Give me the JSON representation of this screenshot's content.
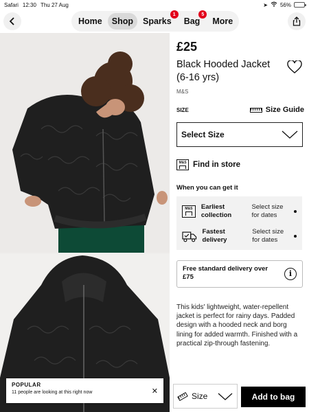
{
  "status_bar": {
    "app": "Safari",
    "time": "12:30",
    "date": "Thu 27 Aug",
    "battery": "56%",
    "battery_level": 0.56
  },
  "nav": {
    "tabs": [
      {
        "label": "Home",
        "active": false
      },
      {
        "label": "Shop",
        "active": true
      },
      {
        "label": "Sparks",
        "badge": "1"
      },
      {
        "label": "Bag",
        "badge": "5"
      },
      {
        "label": "More"
      }
    ]
  },
  "product": {
    "price": "£25",
    "title": "Black Hooded Jacket (6-16 yrs)",
    "brand": "M&S",
    "size_label": "SIZE",
    "size_guide": "Size Guide",
    "select_size": "Select Size",
    "find_in_store": "Find in store",
    "when_get": "When you can get it",
    "store_icon_text": "M&S",
    "delivery_options": [
      {
        "label": "Earliest collection",
        "value": "Select size for dates"
      },
      {
        "label": "Fastest delivery",
        "value": "Select size for dates"
      }
    ],
    "free_delivery": "Free standard delivery over £75",
    "description": "This kids' lightweight, water-repellent jacket is perfect for rainy days. Padded design with a hooded neck and borg lining for added warmth. Finished with a practical zip-through fastening."
  },
  "toast": {
    "title": "POPULAR",
    "message": "11 people are looking at this right now"
  },
  "bottom_bar": {
    "size_label": "Size",
    "add_to_bag": "Add to bag"
  },
  "colors": {
    "badge": "#e2001a",
    "jacket": "#1f1f1f",
    "trousers": "#0d4a36",
    "battery": "#f5c400"
  }
}
